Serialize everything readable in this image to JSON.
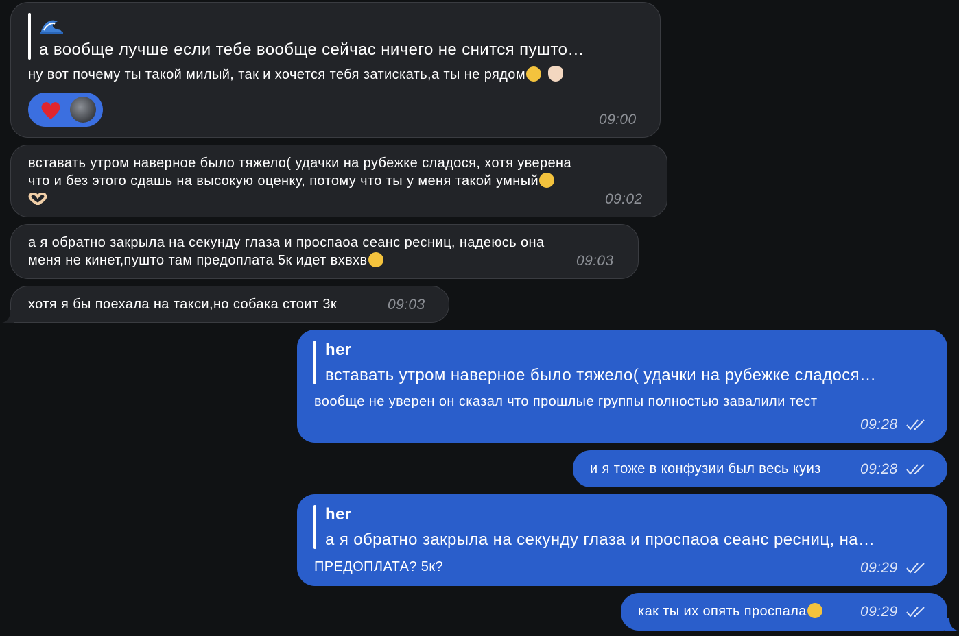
{
  "messages": [
    {
      "direction": "incoming",
      "quote_text": "а вообще лучше если тебе вообще сейчас ничего не снится пушто…",
      "text": "ну вот почему ты такой милый, так и хочется тебя затискать,а ты не рядом",
      "time": "09:00",
      "reactions": [
        "heart-emoji",
        "avatar"
      ]
    },
    {
      "direction": "incoming",
      "lines": [
        "вставать утром наверное было тяжело( удачки на рубежке сладося, хотя уверена",
        "что и без этого сдашь на высокую оценку, потому что ты у меня такой умный"
      ],
      "time": "09:02"
    },
    {
      "direction": "incoming",
      "lines": [
        "а я обратно закрыла на секунду глаза и проспаоа сеанс ресниц, надеюсь она",
        "меня не кинет,пушто там предоплата 5к идет вхвхв"
      ],
      "time": "09:03"
    },
    {
      "direction": "incoming",
      "text": "хотя я бы поехала на такси,но собака стоит 3к",
      "time": "09:03"
    },
    {
      "direction": "outgoing",
      "quote_name": "her",
      "quote_text": "вставать утром наверное было тяжело( удачки на рубежке сладося…",
      "text": "вообще не уверен он сказал что прошлые группы полностью завалили тест",
      "time": "09:28"
    },
    {
      "direction": "outgoing",
      "text": "и я тоже в конфузии был весь куиз",
      "time": "09:28"
    },
    {
      "direction": "outgoing",
      "quote_name": "her",
      "quote_text": "а я обратно закрыла на секунду глаза и проспаоа сеанс ресниц, на…",
      "text": "ПРЕДОПЛАТА? 5к?",
      "time": "09:29"
    },
    {
      "direction": "outgoing",
      "text": "как ты их опять проспала",
      "time": "09:29"
    }
  ],
  "colors": {
    "background": "#101214",
    "incoming_bubble": "#222428",
    "outgoing_bubble": "#2a5ecb",
    "reaction_pill": "#3b6fe0"
  }
}
